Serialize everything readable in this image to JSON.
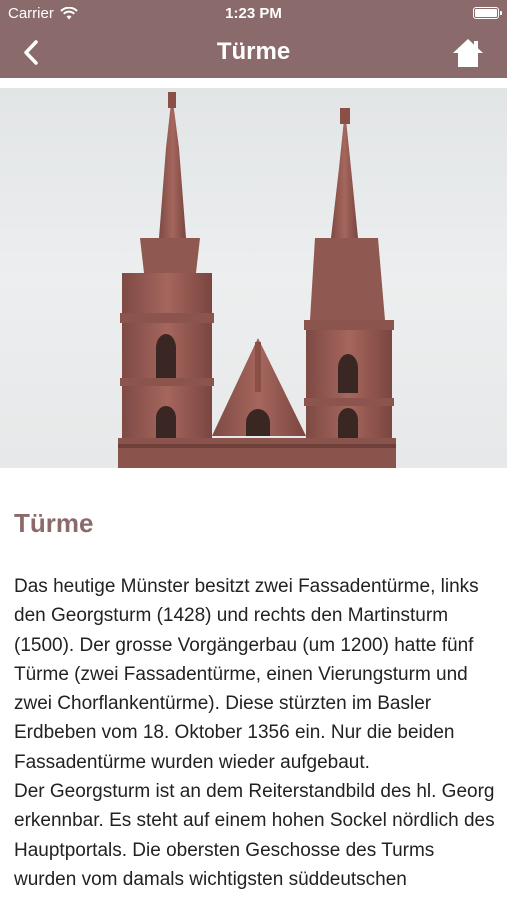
{
  "status_bar": {
    "carrier": "Carrier",
    "time": "1:23 PM"
  },
  "nav": {
    "title": "Türme"
  },
  "content": {
    "heading": "Türme",
    "paragraph1": "Das heutige Münster besitzt zwei Fassadentürme, links den Georgsturm (1428) und rechts den Martinsturm (1500). Der grosse Vorgängerbau (um 1200) hatte fünf Türme (zwei Fassadentürme, einen Vierungsturm und zwei Chorflankentürme). Diese stürzten im Basler Erdbeben vom 18. Oktober 1356 ein. Nur die beiden Fassadentürme wurden wieder aufgebaut.",
    "paragraph2": "Der Georgsturm ist an dem Reiterstandbild des hl. Georg erkennbar. Es steht auf einem hohen Sockel nördlich des Hauptportals. Die obersten Geschosse des Turms wurden vom damals wichtigsten süddeutschen"
  },
  "colors": {
    "accent": "#8a6a6a",
    "sandstone": "#9c5f57"
  }
}
